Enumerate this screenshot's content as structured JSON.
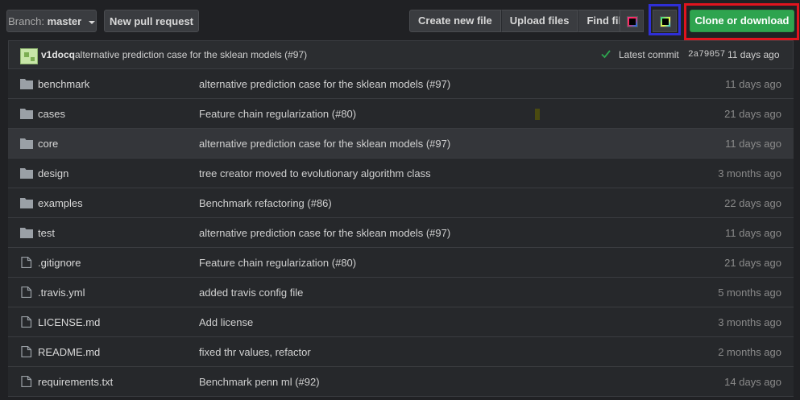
{
  "toolbar": {
    "branch_label": "Branch:",
    "branch_name": "master",
    "new_pr_label": "New pull request",
    "actions": [
      "Create new file",
      "Upload files",
      "Find file"
    ],
    "ide_buttons": [
      "intellij-idea-icon",
      "pycharm-icon"
    ],
    "clone_label": "Clone or download",
    "accent_color": "#2ea44f"
  },
  "commit": {
    "author": "v1docq",
    "message": "alternative prediction case for the sklean models (#97)",
    "latest_label": "Latest commit",
    "sha": "2a79057",
    "age": "11 days ago"
  },
  "files": [
    {
      "type": "folder",
      "name": "benchmark",
      "message": "alternative prediction case for the sklean models (#97)",
      "age": "11 days ago"
    },
    {
      "type": "folder",
      "name": "cases",
      "message": "Feature chain regularization (#80)",
      "age": "21 days ago"
    },
    {
      "type": "folder",
      "name": "core",
      "message": "alternative prediction case for the sklean models (#97)",
      "age": "11 days ago"
    },
    {
      "type": "folder",
      "name": "design",
      "message": "tree creator moved to evolutionary algorithm class",
      "age": "3 months ago"
    },
    {
      "type": "folder",
      "name": "examples",
      "message": "Benchmark refactoring (#86)",
      "age": "22 days ago"
    },
    {
      "type": "folder",
      "name": "test",
      "message": "alternative prediction case for the sklean models (#97)",
      "age": "11 days ago"
    },
    {
      "type": "file",
      "name": ".gitignore",
      "message": "Feature chain regularization (#80)",
      "age": "21 days ago"
    },
    {
      "type": "file",
      "name": ".travis.yml",
      "message": "added travis config file",
      "age": "5 months ago"
    },
    {
      "type": "file",
      "name": "LICENSE.md",
      "message": "Add license",
      "age": "3 months ago"
    },
    {
      "type": "file",
      "name": "README.md",
      "message": "fixed thr values, refactor",
      "age": "2 months ago"
    },
    {
      "type": "file",
      "name": "requirements.txt",
      "message": "Benchmark penn ml (#92)",
      "age": "14 days ago"
    }
  ]
}
